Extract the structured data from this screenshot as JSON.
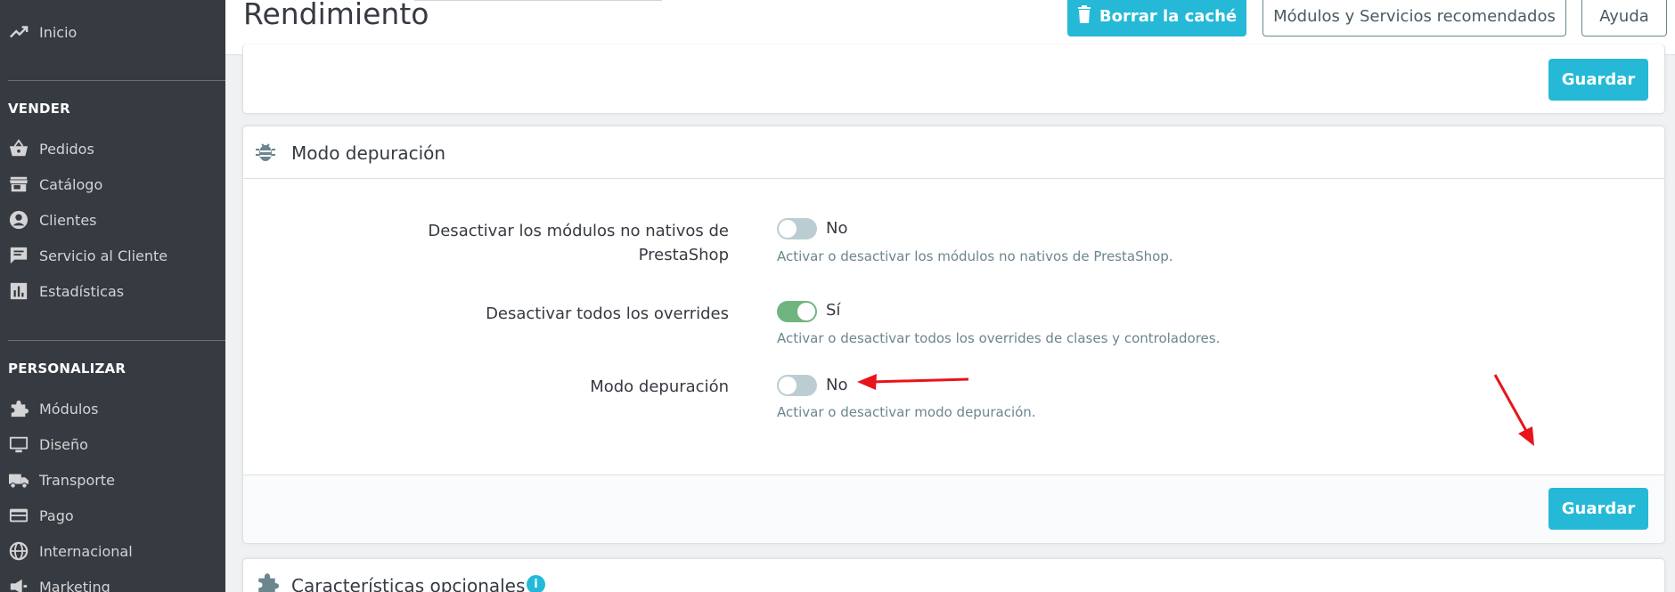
{
  "sidebar": {
    "top_item": {
      "label": "Inicio",
      "icon": "trending-up-icon"
    },
    "section_sell": "VENDER",
    "sell_items": [
      {
        "label": "Pedidos",
        "icon": "shopping-basket-icon"
      },
      {
        "label": "Catálogo",
        "icon": "store-icon"
      },
      {
        "label": "Clientes",
        "icon": "account-circle-icon"
      },
      {
        "label": "Servicio al Cliente",
        "icon": "chat-icon"
      },
      {
        "label": "Estadísticas",
        "icon": "bar-chart-icon"
      }
    ],
    "section_customize": "PERSONALIZAR",
    "customize_items": [
      {
        "label": "Módulos",
        "icon": "puzzle-icon"
      },
      {
        "label": "Diseño",
        "icon": "desktop-icon"
      },
      {
        "label": "Transporte",
        "icon": "truck-icon"
      },
      {
        "label": "Pago",
        "icon": "credit-card-icon"
      },
      {
        "label": "Internacional",
        "icon": "globe-icon"
      },
      {
        "label": "Marketing",
        "icon": "megaphone-icon"
      }
    ]
  },
  "header": {
    "title": "Rendimiento",
    "clear_cache_label": "Borrar la caché",
    "modules_label": "Módulos y Servicios recomendados",
    "help_label": "Ayuda"
  },
  "panel_top": {
    "save_label": "Guardar"
  },
  "debug_panel": {
    "title": "Modo depuración",
    "fields": [
      {
        "label_line1": "Desactivar los módulos no nativos de",
        "label_line2": "PrestaShop",
        "state": "No",
        "on": false,
        "help": "Activar o desactivar los módulos no nativos de PrestaShop."
      },
      {
        "label_line1": "Desactivar todos los overrides",
        "state": "Sí",
        "on": true,
        "help": "Activar o desactivar todos los overrides de clases y controladores."
      },
      {
        "label_line1": "Modo depuración",
        "state": "No",
        "on": false,
        "help": "Activar o desactivar modo depuración."
      }
    ],
    "save_label": "Guardar"
  },
  "optional_panel": {
    "title": "Características opcionales",
    "info": "i"
  },
  "colors": {
    "primary": "#25b9d7",
    "switch_on": "#70b580",
    "switch_off": "#bbcdd2",
    "annotation_arrow": "#e8141b",
    "sidebar_bg": "#363a41"
  }
}
